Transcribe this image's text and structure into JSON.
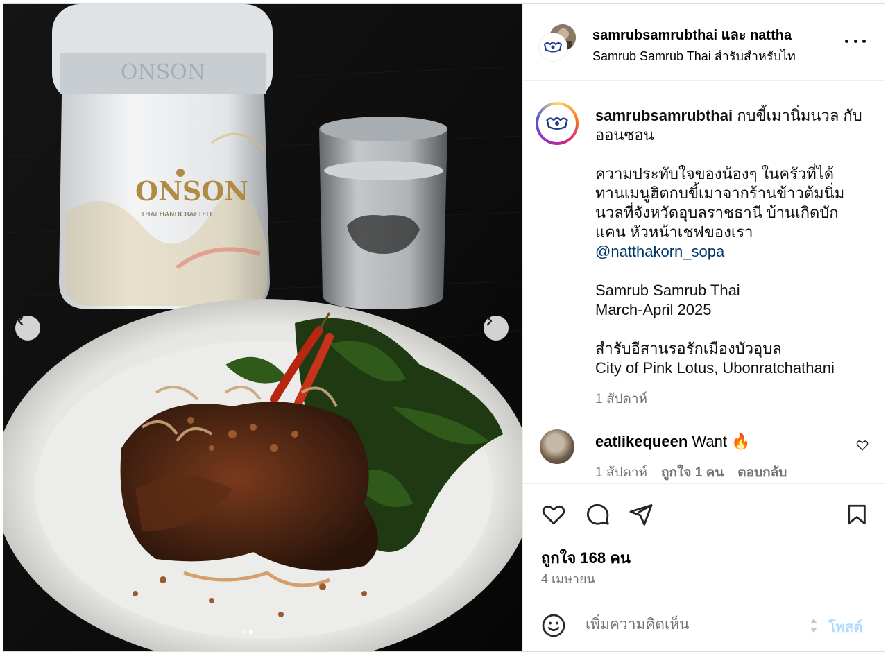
{
  "post_image": {
    "bottle_brand": "ONSON",
    "bottle_embossed": "ONSON",
    "bottle_subtext": "THAI HANDCRAFTED",
    "carousel_dots": 2,
    "carousel_active": 1
  },
  "header": {
    "username": "samrubsamrubthai",
    "and_text": "และ",
    "collab_user": "nattha",
    "location": "Samrub Samrub Thai สำรับสำหรับไท"
  },
  "caption": {
    "username": "samrubsamrubthai",
    "title_line1": "กบขี้เมานิ่มนวล กับ",
    "title_line2": "ออนซอน",
    "para_lines": [
      "ความประทับใจของน้องๆ ในครัวที่ได้",
      "ทานเมนูฮิตกบขี้เมาจากร้านข้าวต้มนิ่ม",
      "นวลที่จังหวัดอุบลราชธานี บ้านเกิดบัก",
      "แคน หัวหน้าเชฟของเรา"
    ],
    "mention": "@natthakorn_sopa",
    "event_name": "Samrub Samrub Thai",
    "event_dates": "March-April 2025",
    "theme_thai": "สำรับอีสานรอรักเมืองบัวอุบล",
    "theme_en": "City of Pink Lotus, Ubonratchathani",
    "time": "1 สัปดาห์"
  },
  "comment": {
    "username": "eatlikequeen",
    "text": "Want",
    "emoji": "🔥",
    "time": "1 สัปดาห์",
    "likes": "ถูกใจ 1 คน",
    "reply": "ตอบกลับ"
  },
  "actions": {
    "likes": "ถูกใจ 168 คน",
    "date": "4 เมษายน"
  },
  "composer": {
    "placeholder": "เพิ่มความคิดเห็น",
    "post_label": "โพสต์"
  },
  "colors": {
    "link": "#00376b",
    "secondary_text": "#737373",
    "post_disabled": "#b3dbff"
  }
}
